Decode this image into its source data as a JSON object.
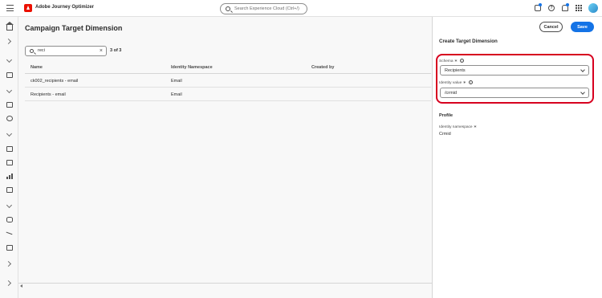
{
  "header": {
    "app_title": "Adobe Journey Optimizer",
    "search_placeholder": "Search Experience Cloud (Ctrl+/)",
    "help_glyph": "?"
  },
  "rail": {
    "icons": [
      "home-icon",
      "chevron-right-icon",
      "chevron-down-icon",
      "table-icon",
      "chevron-down-icon",
      "list-icon",
      "target-icon",
      "chevron-down-icon",
      "flows-icon",
      "table-icon",
      "bar-chart-icon",
      "folder-icon",
      "chevron-down-icon",
      "database-icon",
      "connector-icon",
      "monitor-icon",
      "chevron-right-icon",
      "chevron-right-icon"
    ]
  },
  "main": {
    "title": "Campaign Target Dimension",
    "filter": {
      "value": "reci",
      "clear_glyph": "×"
    },
    "result_count": "3 of 3",
    "columns": [
      "Name",
      "Identity Namespace",
      "Created by"
    ],
    "rows": [
      {
        "name": "ck002_recipients - email",
        "namespace": "Email",
        "created_by": ""
      },
      {
        "name": "Recipients - email",
        "namespace": "Email",
        "created_by": ""
      }
    ]
  },
  "panel": {
    "title": "Create Target Dimension",
    "cancel_label": "Cancel",
    "save_label": "Save",
    "schema_label": "Schema ∗",
    "schema_value": "Recipients",
    "identity_label": "Identity value ∗",
    "identity_value": "/crmid",
    "info_glyph": "i",
    "profile_heading": "Profile",
    "namespace_label": "Identity namespace ∗",
    "namespace_value": "Crmid"
  },
  "colors": {
    "accent": "#1473e6",
    "highlight": "#d7001f",
    "brand": "#eb1000"
  }
}
